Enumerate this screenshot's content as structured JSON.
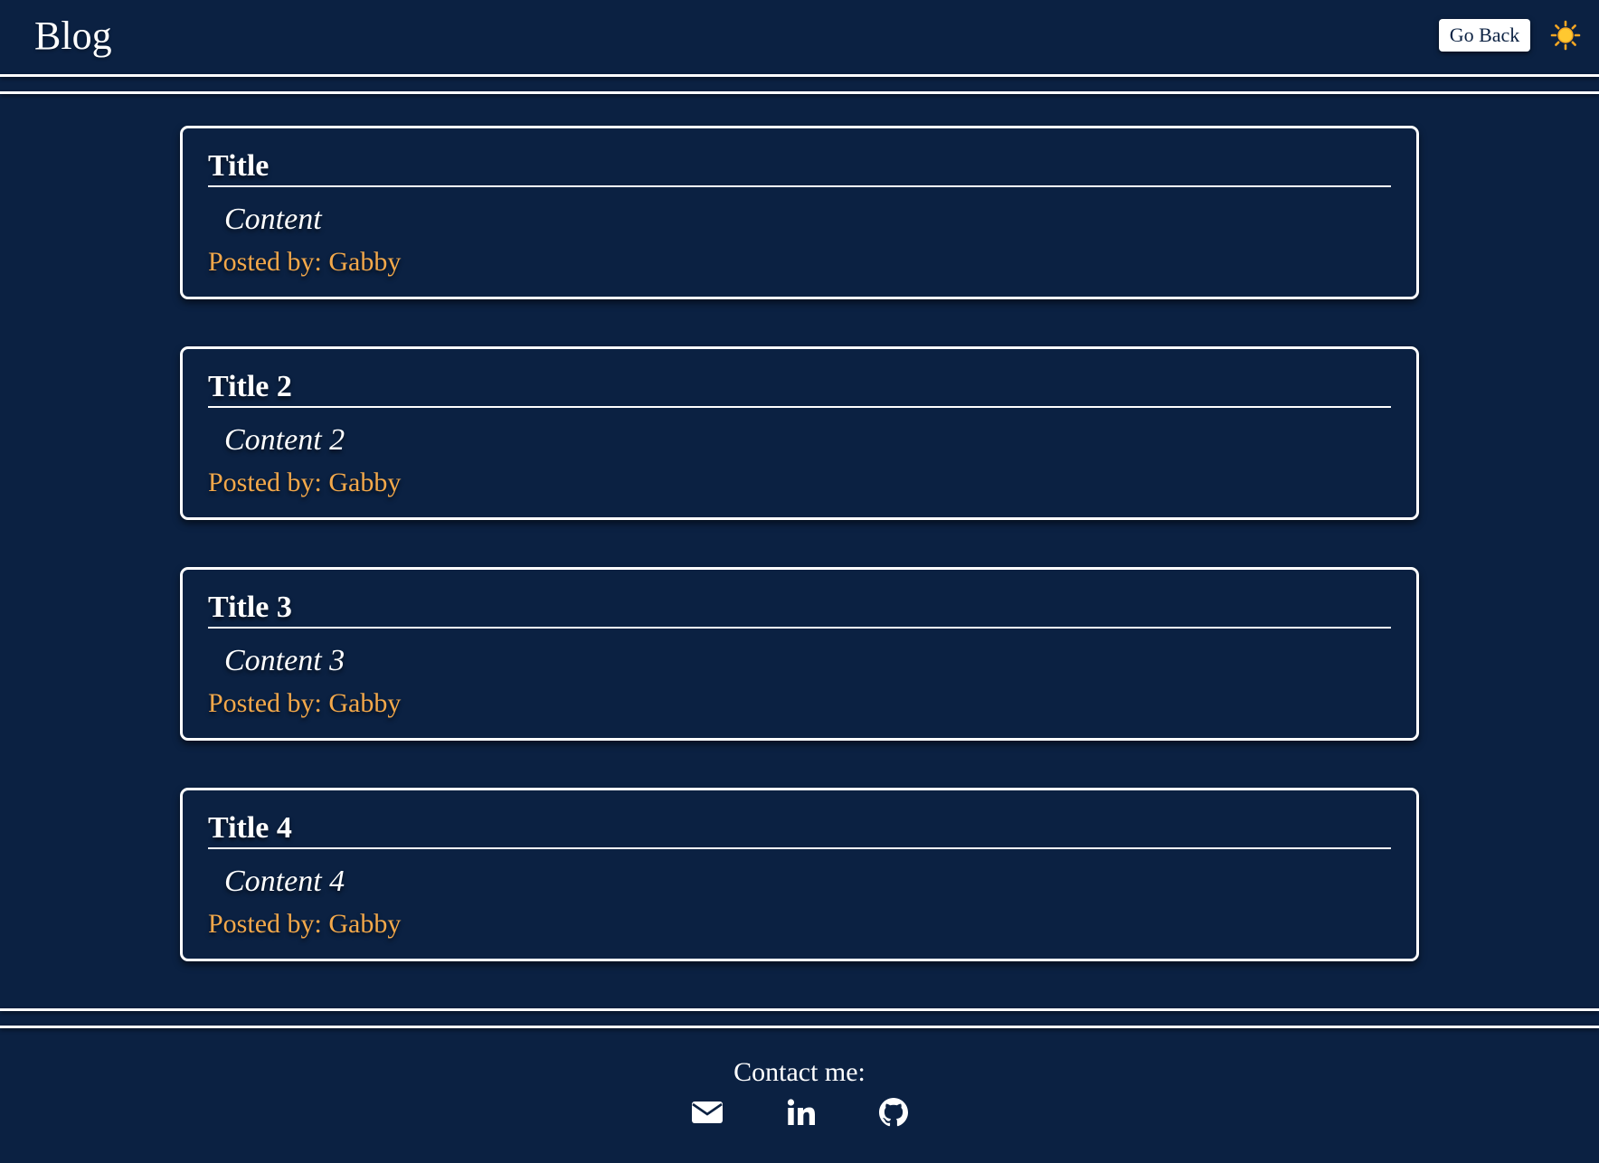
{
  "header": {
    "brand": "Blog",
    "go_back_label": "Go Back",
    "theme_icon": "sun-icon"
  },
  "posts": [
    {
      "title": "Title",
      "content": "Content",
      "author": "Posted by: Gabby"
    },
    {
      "title": "Title 2",
      "content": "Content 2",
      "author": "Posted by: Gabby"
    },
    {
      "title": "Title 3",
      "content": "Content 3",
      "author": "Posted by: Gabby"
    },
    {
      "title": "Title 4",
      "content": "Content 4",
      "author": "Posted by: Gabby"
    }
  ],
  "footer": {
    "contact_label": "Contact me:",
    "icons": [
      "envelope-icon",
      "linkedin-icon",
      "github-icon"
    ]
  },
  "colors": {
    "background": "#0b2142",
    "text": "#ffffff",
    "author": "#f3a84a",
    "sun": "#f5a623"
  }
}
